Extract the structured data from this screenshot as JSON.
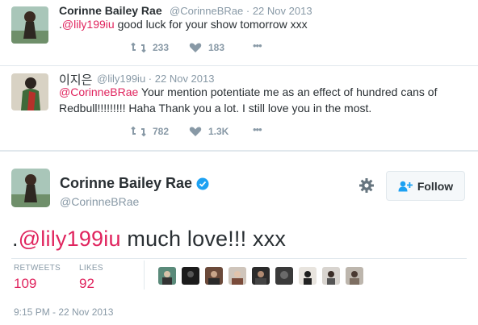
{
  "tweet1": {
    "name": "Corinne Bailey Rae",
    "handle": "@CorinneBRae",
    "date": "22 Nov 2013",
    "prefix": ".",
    "mention": "@lily199iu",
    "text": " good luck for your show tomorrow xxx",
    "retweets": "233",
    "likes": "183",
    "more": "•••"
  },
  "tweet2": {
    "name": "이지은",
    "handle": "@lily199iu",
    "date": "22 Nov 2013",
    "mention": "@CorinneBRae",
    "text_line1": " Your mention potentiate me as an effect of hundred cans of",
    "text_line2": "Redbull!!!!!!!!! Haha Thank you a lot. I still love you in the most.",
    "retweets": "782",
    "likes": "1.3K",
    "more": "•••"
  },
  "main_tweet": {
    "name": "Corinne Bailey Rae",
    "handle": "@CorinneBRae",
    "follow_label": "Follow",
    "prefix": ".",
    "mention": "@lily199iu",
    "text": " much love!!! xxx",
    "retweets_label": "RETWEETS",
    "retweets": "109",
    "likes_label": "LIKES",
    "likes": "92",
    "timestamp": "9:15 PM - 22 Nov 2013"
  },
  "colors": {
    "accent": "#e0245e",
    "link": "#1da1f2",
    "muted": "#8899a6",
    "verified": "#1da1f2"
  }
}
